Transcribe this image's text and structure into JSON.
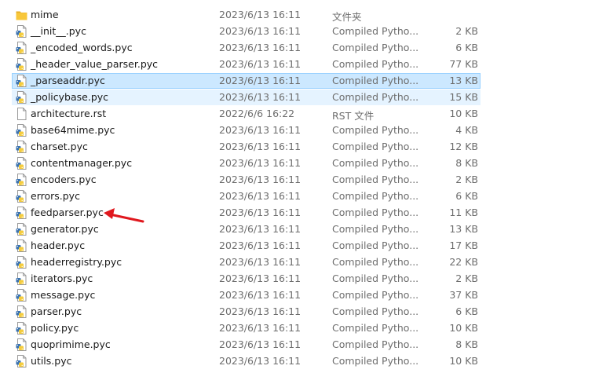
{
  "files": [
    {
      "name": "mime",
      "date": "2023/6/13 16:11",
      "type": "文件夹",
      "size": "",
      "icon": "folder-icon"
    },
    {
      "name": "__init__.pyc",
      "date": "2023/6/13 16:11",
      "type": "Compiled Pytho...",
      "size": "2 KB",
      "icon": "python-file-icon"
    },
    {
      "name": "_encoded_words.pyc",
      "date": "2023/6/13 16:11",
      "type": "Compiled Pytho...",
      "size": "6 KB",
      "icon": "python-file-icon"
    },
    {
      "name": "_header_value_parser.pyc",
      "date": "2023/6/13 16:11",
      "type": "Compiled Pytho...",
      "size": "77 KB",
      "icon": "python-file-icon"
    },
    {
      "name": "_parseaddr.pyc",
      "date": "2023/6/13 16:11",
      "type": "Compiled Pytho...",
      "size": "13 KB",
      "icon": "python-file-icon",
      "state": "selected"
    },
    {
      "name": "_policybase.pyc",
      "date": "2023/6/13 16:11",
      "type": "Compiled Pytho...",
      "size": "15 KB",
      "icon": "python-file-icon",
      "state": "hover"
    },
    {
      "name": "architecture.rst",
      "date": "2022/6/6 16:22",
      "type": "RST 文件",
      "size": "10 KB",
      "icon": "text-file-icon"
    },
    {
      "name": "base64mime.pyc",
      "date": "2023/6/13 16:11",
      "type": "Compiled Pytho...",
      "size": "4 KB",
      "icon": "python-file-icon"
    },
    {
      "name": "charset.pyc",
      "date": "2023/6/13 16:11",
      "type": "Compiled Pytho...",
      "size": "12 KB",
      "icon": "python-file-icon"
    },
    {
      "name": "contentmanager.pyc",
      "date": "2023/6/13 16:11",
      "type": "Compiled Pytho...",
      "size": "8 KB",
      "icon": "python-file-icon"
    },
    {
      "name": "encoders.pyc",
      "date": "2023/6/13 16:11",
      "type": "Compiled Pytho...",
      "size": "2 KB",
      "icon": "python-file-icon"
    },
    {
      "name": "errors.pyc",
      "date": "2023/6/13 16:11",
      "type": "Compiled Pytho...",
      "size": "6 KB",
      "icon": "python-file-icon"
    },
    {
      "name": "feedparser.pyc",
      "date": "2023/6/13 16:11",
      "type": "Compiled Pytho...",
      "size": "11 KB",
      "icon": "python-file-icon"
    },
    {
      "name": "generator.pyc",
      "date": "2023/6/13 16:11",
      "type": "Compiled Pytho...",
      "size": "13 KB",
      "icon": "python-file-icon"
    },
    {
      "name": "header.pyc",
      "date": "2023/6/13 16:11",
      "type": "Compiled Pytho...",
      "size": "17 KB",
      "icon": "python-file-icon"
    },
    {
      "name": "headerregistry.pyc",
      "date": "2023/6/13 16:11",
      "type": "Compiled Pytho...",
      "size": "22 KB",
      "icon": "python-file-icon"
    },
    {
      "name": "iterators.pyc",
      "date": "2023/6/13 16:11",
      "type": "Compiled Pytho...",
      "size": "2 KB",
      "icon": "python-file-icon"
    },
    {
      "name": "message.pyc",
      "date": "2023/6/13 16:11",
      "type": "Compiled Pytho...",
      "size": "37 KB",
      "icon": "python-file-icon"
    },
    {
      "name": "parser.pyc",
      "date": "2023/6/13 16:11",
      "type": "Compiled Pytho...",
      "size": "6 KB",
      "icon": "python-file-icon"
    },
    {
      "name": "policy.pyc",
      "date": "2023/6/13 16:11",
      "type": "Compiled Pytho...",
      "size": "10 KB",
      "icon": "python-file-icon"
    },
    {
      "name": "quoprimime.pyc",
      "date": "2023/6/13 16:11",
      "type": "Compiled Pytho...",
      "size": "8 KB",
      "icon": "python-file-icon"
    },
    {
      "name": "utils.pyc",
      "date": "2023/6/13 16:11",
      "type": "Compiled Pytho...",
      "size": "10 KB",
      "icon": "python-file-icon"
    }
  ],
  "annotation": {
    "icon": "red-arrow-icon",
    "color": "#e0181e",
    "points_to": "feedparser.pyc"
  },
  "colors": {
    "selected_bg": "#cce8ff",
    "selected_border": "#99d1ff",
    "hover_bg": "#e5f3ff",
    "secondary_text": "#6d6d6d",
    "folder": "#f8c73a"
  }
}
